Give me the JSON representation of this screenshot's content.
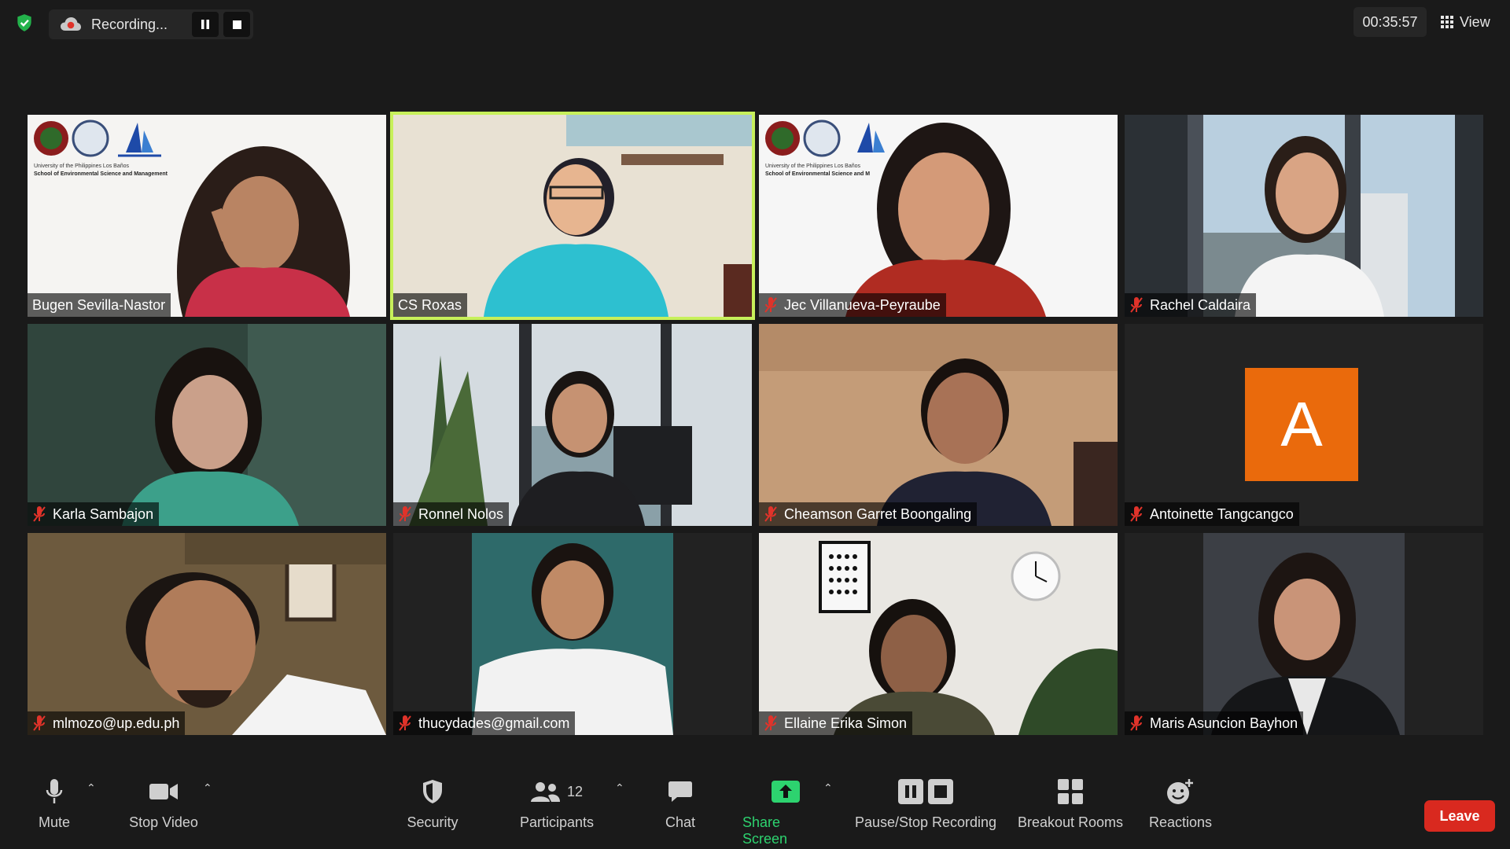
{
  "recording": {
    "label": "Recording..."
  },
  "timer": "00:35:57",
  "view_label": "View",
  "participants": [
    {
      "name": "Bugen Sevilla-Nastor",
      "muted": false,
      "active": false,
      "scene": "logo-white"
    },
    {
      "name": "CS Roxas",
      "muted": false,
      "active": true,
      "scene": "room-light"
    },
    {
      "name": "Jec Villanueva-Peyraube",
      "muted": true,
      "active": false,
      "scene": "logo-white"
    },
    {
      "name": "Rachel Caldaira",
      "muted": true,
      "active": false,
      "scene": "window-city"
    },
    {
      "name": "Karla Sambajon",
      "muted": true,
      "active": false,
      "scene": "pattern-green"
    },
    {
      "name": "Ronnel Nolos",
      "muted": true,
      "active": false,
      "scene": "plants-window"
    },
    {
      "name": "Cheamson Garret Boongaling",
      "muted": true,
      "active": false,
      "scene": "room-warm"
    },
    {
      "name": "Antoinette Tangcangco",
      "muted": true,
      "active": false,
      "scene": "avatar",
      "avatar_letter": "A"
    },
    {
      "name": "mlmozo@up.edu.ph",
      "muted": true,
      "active": false,
      "scene": "room-dim"
    },
    {
      "name": "thucydades@gmail.com",
      "muted": true,
      "active": false,
      "scene": "portrait-teal"
    },
    {
      "name": "Ellaine Erika Simon",
      "muted": true,
      "active": false,
      "scene": "brick-white"
    },
    {
      "name": "Maris Asuncion Bayhon",
      "muted": true,
      "active": false,
      "scene": "portrait-dark"
    }
  ],
  "logo_caption": {
    "line1": "University of the Philippines Los Baños",
    "line2": "School of Environmental Science and Management",
    "line2_short": "School of Environmental Science and M"
  },
  "toolbar": {
    "mute": "Mute",
    "stop_video": "Stop Video",
    "security": "Security",
    "participants": "Participants",
    "participants_count": "12",
    "chat": "Chat",
    "share_screen": "Share Screen",
    "pause_stop_recording": "Pause/Stop Recording",
    "breakout_rooms": "Breakout Rooms",
    "reactions": "Reactions",
    "leave": "Leave"
  },
  "colors": {
    "background": "#1a1a1a",
    "active_speaker": "#c7f05a",
    "share_screen": "#2dd36f",
    "leave": "#d9291f",
    "avatar": "#ea6a0c",
    "muted_mic": "#e0332a"
  }
}
